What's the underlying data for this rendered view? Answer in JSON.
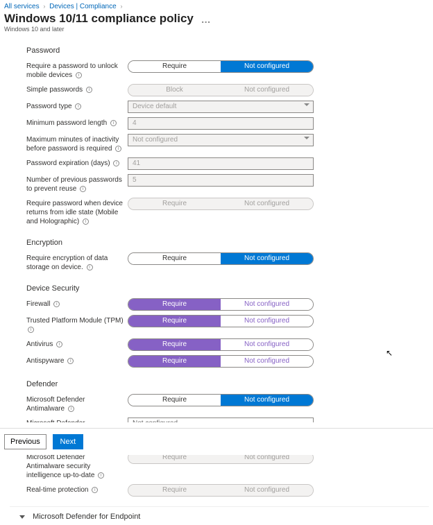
{
  "breadcrumbs": {
    "b1": "All services",
    "b2": "Devices | Compliance"
  },
  "page": {
    "title": "Windows 10/11 compliance policy",
    "subtitle": "Windows 10 and later"
  },
  "sections": {
    "password": "Password",
    "encryption": "Encryption",
    "device_security": "Device Security",
    "defender": "Defender",
    "defender_endpoint": "Microsoft Defender for Endpoint"
  },
  "labels": {
    "req_password": "Require a password to unlock mobile devices",
    "simple_pw": "Simple passwords",
    "pw_type": "Password type",
    "min_len": "Minimum password length",
    "max_inactive": "Maximum minutes of inactivity before password is required",
    "pw_expire": "Password expiration (days)",
    "prev_pw": "Number of previous passwords to prevent reuse",
    "idle_return": "Require password when device returns from idle state (Mobile and Holographic)",
    "req_encrypt": "Require encryption of data storage on device.",
    "firewall": "Firewall",
    "tpm": "Trusted Platform Module (TPM)",
    "antivirus": "Antivirus",
    "antispy": "Antispyware",
    "def_antimal": "Microsoft Defender Antimalware",
    "def_minver": "Microsoft Defender Antimalware minimum version",
    "def_intel": "Microsoft Defender Antimalware security intelligence up-to-date",
    "realtime": "Real-time protection"
  },
  "options": {
    "require": "Require",
    "block": "Block",
    "not_configured": "Not configured"
  },
  "values": {
    "pw_type": "Device default",
    "min_len": "4",
    "max_inactive": "Not configured",
    "pw_expire": "41",
    "prev_pw": "5",
    "def_minver": "Not configured"
  },
  "buttons": {
    "previous": "Previous",
    "next": "Next"
  }
}
